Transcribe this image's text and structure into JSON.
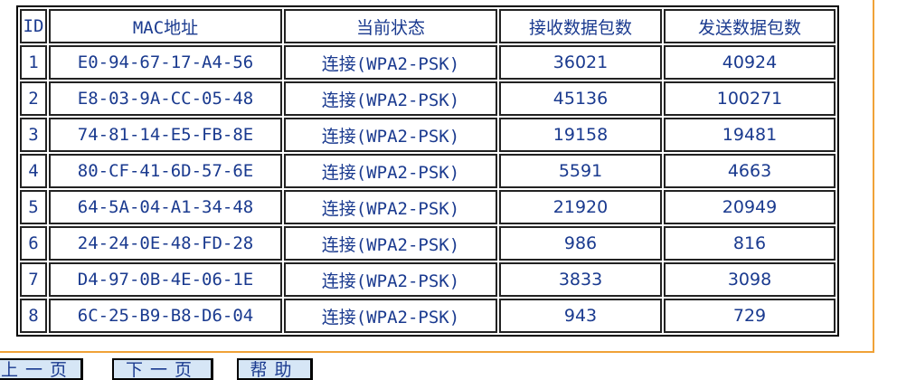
{
  "table": {
    "headers": {
      "id": "ID",
      "mac": "MAC地址",
      "state": "当前状态",
      "rx": "接收数据包数",
      "tx": "发送数据包数"
    },
    "rows": [
      {
        "id": "1",
        "mac": "E0-94-67-17-A4-56",
        "state": "连接(WPA2-PSK)",
        "rx": "36021",
        "tx": "40924"
      },
      {
        "id": "2",
        "mac": "E8-03-9A-CC-05-48",
        "state": "连接(WPA2-PSK)",
        "rx": "45136",
        "tx": "100271"
      },
      {
        "id": "3",
        "mac": "74-81-14-E5-FB-8E",
        "state": "连接(WPA2-PSK)",
        "rx": "19158",
        "tx": "19481"
      },
      {
        "id": "4",
        "mac": "80-CF-41-6D-57-6E",
        "state": "连接(WPA2-PSK)",
        "rx": "5591",
        "tx": "4663"
      },
      {
        "id": "5",
        "mac": "64-5A-04-A1-34-48",
        "state": "连接(WPA2-PSK)",
        "rx": "21920",
        "tx": "20949"
      },
      {
        "id": "6",
        "mac": "24-24-0E-48-FD-28",
        "state": "连接(WPA2-PSK)",
        "rx": "986",
        "tx": "816"
      },
      {
        "id": "7",
        "mac": "D4-97-0B-4E-06-1E",
        "state": "连接(WPA2-PSK)",
        "rx": "3833",
        "tx": "3098"
      },
      {
        "id": "8",
        "mac": "6C-25-B9-B8-D6-04",
        "state": "连接(WPA2-PSK)",
        "rx": "943",
        "tx": "729"
      }
    ]
  },
  "buttons": {
    "prev": "上一页",
    "next": "下一页",
    "help": "帮助"
  },
  "colors": {
    "text": "#1a3a8f",
    "panel_border": "#f0a238",
    "button_bg": "#d6e6f6"
  }
}
